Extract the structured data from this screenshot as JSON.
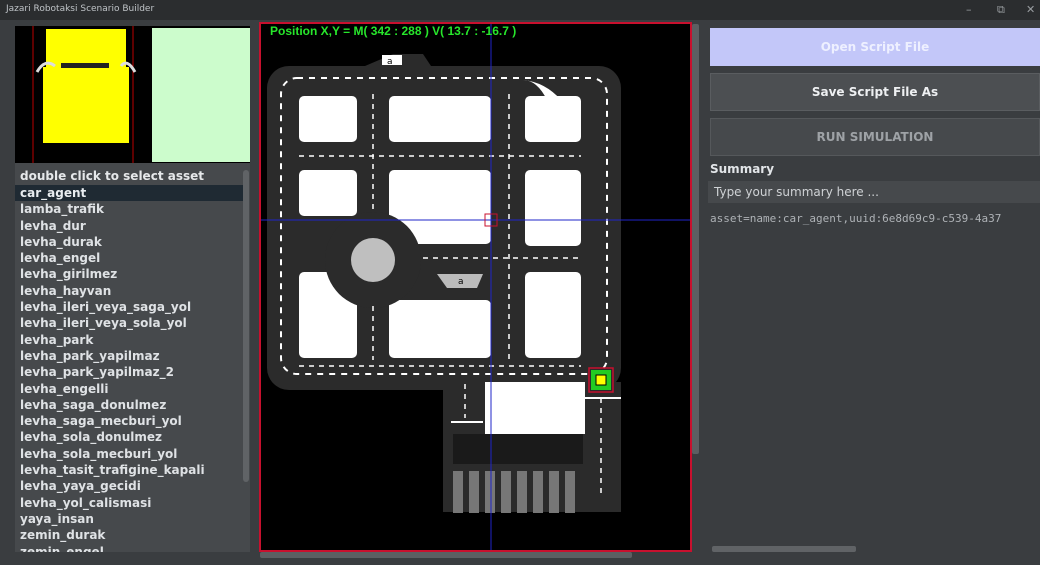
{
  "window": {
    "title": "Jazari Robotaksi Scenario Builder",
    "minimize_icon": "minimize-icon",
    "maximize_icon": "maximize-icon",
    "close_icon": "close-icon"
  },
  "asset_panel": {
    "header": "double click to select asset",
    "selected_index": 0,
    "items": [
      "car_agent",
      "lamba_trafik",
      "levha_dur",
      "levha_durak",
      "levha_engel",
      "levha_girilmez",
      "levha_hayvan",
      "levha_ileri_veya_saga_yol",
      "levha_ileri_veya_sola_yol",
      "levha_park",
      "levha_park_yapilmaz",
      "levha_park_yapilmaz_2",
      "levha_engelli",
      "levha_saga_donulmez",
      "levha_saga_mecburi_yol",
      "levha_sola_donulmez",
      "levha_sola_mecburi_yol",
      "levha_tasit_trafigine_kapali",
      "levha_yaya_gecidi",
      "levha_yol_calismasi",
      "yaya_insan",
      "zemin_durak",
      "zemin_engel"
    ]
  },
  "canvas": {
    "position_readout": "Position X,Y = M( 342 : 288 ) V( 13.7 : -16.7 )",
    "park_sign_label": "a",
    "colors": {
      "road": "#2b2b2b",
      "block": "#ffffff",
      "crosshair": "#1f24c8",
      "border": "#c8102e",
      "readout": "#27e62b"
    }
  },
  "buttons": {
    "open": "Open Script File",
    "save": "Save Script File As",
    "run": "RUN SIMULATION"
  },
  "summary": {
    "label": "Summary",
    "placeholder": "Type your summary here ..."
  },
  "script_text": "asset=name:car_agent,uuid:6e8d69c9-c539-4a37"
}
